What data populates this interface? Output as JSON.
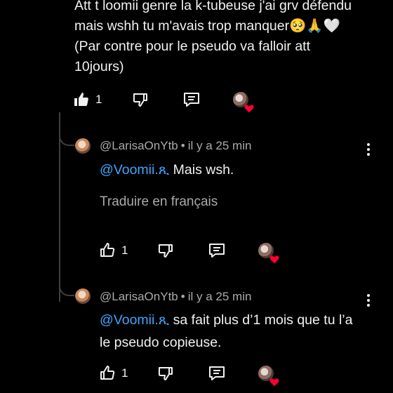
{
  "main_comment": {
    "lines": [
      "Att t loomii genre la k-tubeuse j'ai grv défendu",
      "mais wshh tu m'avais trop manquer🥺🙏🤍",
      "(Par contre pour le pseudo va falloir att",
      "10jours)"
    ],
    "like_count": "1"
  },
  "replies": [
    {
      "author": "@LarisaOnYtb",
      "separator": "•",
      "time": "il y a 25 min",
      "mention": "@Voomii.ጺ",
      "text_line1": " Mais wsh.",
      "text_line2": "",
      "translate_label": "Traduire en français",
      "like_count": "1"
    },
    {
      "author": "@LarisaOnYtb",
      "separator": "•",
      "time": "il y a 25 min",
      "mention": "@Voomii.ጺ",
      "text_line1": " sa fait plus d’1 mois que tu l’a",
      "text_line2": "le pseudo copieuse.",
      "translate_label": "",
      "like_count": "1"
    }
  ],
  "icons": {
    "like": "thumbs-up-icon",
    "dislike": "thumbs-down-icon",
    "reply": "reply-comment-icon",
    "creator_heart": "creator-heart-icon",
    "more": "more-vert-icon"
  },
  "colors": {
    "background": "#000000",
    "text": "#f1f1f1",
    "secondary_text": "#aaaaaa",
    "mention": "#3ea6ff",
    "heart": "#ff0033"
  }
}
